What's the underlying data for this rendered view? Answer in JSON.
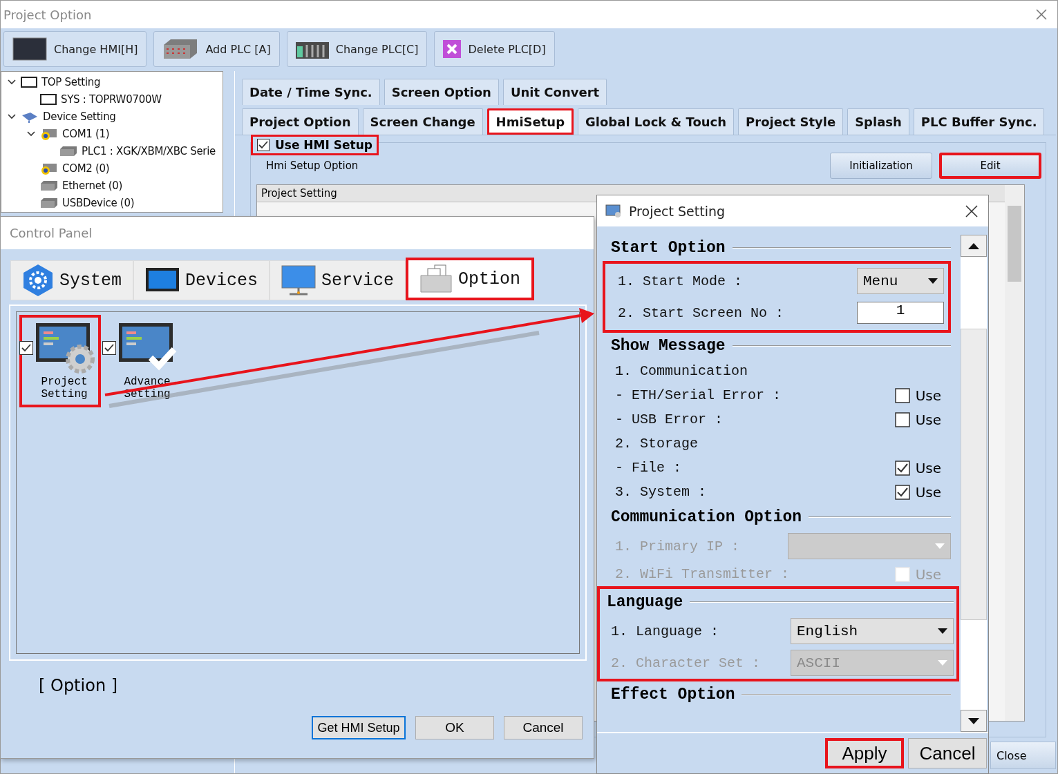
{
  "window": {
    "title": "Project Option"
  },
  "toolbar": [
    {
      "label": "Change HMI[H]",
      "kind": "hmi"
    },
    {
      "label": "Add PLC [A]",
      "kind": "rack"
    },
    {
      "label": "Change PLC[C]",
      "kind": "plc"
    },
    {
      "label": "Delete PLC[D]",
      "kind": "delete"
    }
  ],
  "tree": [
    {
      "label": "TOP Setting",
      "kind": "screen",
      "expanded": true,
      "children": [
        {
          "label": "SYS : TOPRW0700W",
          "kind": "screen"
        }
      ]
    },
    {
      "label": "Device Setting",
      "kind": "network",
      "expanded": true,
      "children": [
        {
          "label": "COM1 (1)",
          "kind": "port",
          "expanded": true,
          "children": [
            {
              "label": "PLC1 : XGK/XBM/XBC Serie",
              "kind": "device"
            }
          ]
        },
        {
          "label": "COM2 (0)",
          "kind": "port"
        },
        {
          "label": "Ethernet (0)",
          "kind": "device"
        },
        {
          "label": "USBDevice (0)",
          "kind": "device"
        }
      ]
    }
  ],
  "tab_rows": [
    {
      "tabs": [
        {
          "label": "Date / Time Sync.",
          "selected": false,
          "highlighted": false
        },
        {
          "label": "Screen Option",
          "selected": false,
          "highlighted": false
        },
        {
          "label": "Unit Convert",
          "selected": false,
          "highlighted": false
        }
      ]
    },
    {
      "tabs": [
        {
          "label": "Project Option",
          "selected": false,
          "highlighted": false
        },
        {
          "label": "Screen Change",
          "selected": false,
          "highlighted": false
        },
        {
          "label": "HmiSetup",
          "selected": true,
          "highlighted": true
        },
        {
          "label": "Global Lock & Touch",
          "selected": false,
          "highlighted": false
        },
        {
          "label": "Project Style",
          "selected": false,
          "highlighted": false
        },
        {
          "label": "Splash",
          "selected": false,
          "highlighted": false
        },
        {
          "label": "PLC Buffer Sync.",
          "selected": false,
          "highlighted": false
        }
      ]
    }
  ],
  "hmi_setup": {
    "use_checkbox": {
      "label": "Use HMI Setup",
      "checked": true,
      "highlighted": true
    },
    "option_label": "Hmi Setup Option",
    "buttons": [
      {
        "label": "Initialization",
        "highlighted": false
      },
      {
        "label": "Edit",
        "highlighted": true
      }
    ],
    "list_header": "Project Setting",
    "close_label": "Close"
  },
  "control_panel": {
    "title": "Control Panel",
    "tabs": [
      {
        "label": "System",
        "kind": "system",
        "selected": false,
        "highlighted": false
      },
      {
        "label": "Devices",
        "kind": "devices",
        "selected": false,
        "highlighted": false
      },
      {
        "label": "Service",
        "kind": "service",
        "selected": false,
        "highlighted": false
      },
      {
        "label": "Option",
        "kind": "option",
        "selected": true,
        "highlighted": true
      }
    ],
    "items": [
      {
        "label": "Project Setting",
        "kind": "gear",
        "checked": true,
        "highlighted": true
      },
      {
        "label": "Advance Setting",
        "kind": "check",
        "checked": true,
        "highlighted": false
      }
    ],
    "caption": "[ Option ]",
    "buttons": [
      {
        "label": "Get HMI Setup",
        "focused": true
      },
      {
        "label": "OK",
        "focused": false
      },
      {
        "label": "Cancel",
        "focused": false
      }
    ]
  },
  "dialog": {
    "title": "Project Setting",
    "sections": [
      {
        "title": "Start Option",
        "rows_highlighted": true,
        "rows": [
          {
            "kind": "dropdown",
            "label": "1. Start Mode :",
            "value": "Menu",
            "disabled": false
          },
          {
            "kind": "input",
            "label": "2. Start Screen No :",
            "value": "1"
          }
        ]
      },
      {
        "title": "Show Message",
        "rows": [
          {
            "kind": "text",
            "label": "1. Communication"
          },
          {
            "kind": "checkbox",
            "label": "- ETH/Serial Error :",
            "option": "Use",
            "checked": false,
            "disabled": false
          },
          {
            "kind": "checkbox",
            "label": "- USB Error :",
            "option": "Use",
            "checked": false,
            "disabled": false
          },
          {
            "kind": "text",
            "label": "2. Storage"
          },
          {
            "kind": "checkbox",
            "label": "- File :",
            "option": "Use",
            "checked": true,
            "disabled": false
          },
          {
            "kind": "checkbox",
            "label": "3. System :",
            "option": "Use",
            "checked": true,
            "disabled": false
          }
        ]
      },
      {
        "title": "Communication Option",
        "rows": [
          {
            "kind": "dropdown",
            "label": "1. Primary IP :",
            "disabled": true
          },
          {
            "kind": "checkbox",
            "label": "2. WiFi Transmitter :",
            "option": "Use",
            "checked": false,
            "disabled": true
          }
        ]
      },
      {
        "title": "Language",
        "highlighted": true,
        "rows": [
          {
            "kind": "dropdown",
            "label": "1. Language :",
            "value": "English",
            "disabled": false
          },
          {
            "kind": "dropdown",
            "label": "2. Character Set :",
            "value": "ASCII",
            "disabled": true
          }
        ]
      },
      {
        "title": "Effect Option"
      }
    ],
    "buttons": [
      {
        "label": "Apply",
        "highlighted": true
      },
      {
        "label": "Cancel",
        "highlighted": false
      }
    ]
  }
}
